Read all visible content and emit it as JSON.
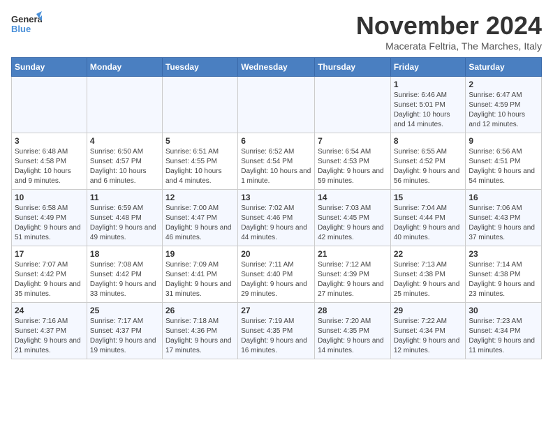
{
  "header": {
    "logo_general": "General",
    "logo_blue": "Blue",
    "month": "November 2024",
    "location": "Macerata Feltria, The Marches, Italy"
  },
  "weekdays": [
    "Sunday",
    "Monday",
    "Tuesday",
    "Wednesday",
    "Thursday",
    "Friday",
    "Saturday"
  ],
  "weeks": [
    [
      {
        "day": "",
        "info": ""
      },
      {
        "day": "",
        "info": ""
      },
      {
        "day": "",
        "info": ""
      },
      {
        "day": "",
        "info": ""
      },
      {
        "day": "",
        "info": ""
      },
      {
        "day": "1",
        "info": "Sunrise: 6:46 AM\nSunset: 5:01 PM\nDaylight: 10 hours and 14 minutes."
      },
      {
        "day": "2",
        "info": "Sunrise: 6:47 AM\nSunset: 4:59 PM\nDaylight: 10 hours and 12 minutes."
      }
    ],
    [
      {
        "day": "3",
        "info": "Sunrise: 6:48 AM\nSunset: 4:58 PM\nDaylight: 10 hours and 9 minutes."
      },
      {
        "day": "4",
        "info": "Sunrise: 6:50 AM\nSunset: 4:57 PM\nDaylight: 10 hours and 6 minutes."
      },
      {
        "day": "5",
        "info": "Sunrise: 6:51 AM\nSunset: 4:55 PM\nDaylight: 10 hours and 4 minutes."
      },
      {
        "day": "6",
        "info": "Sunrise: 6:52 AM\nSunset: 4:54 PM\nDaylight: 10 hours and 1 minute."
      },
      {
        "day": "7",
        "info": "Sunrise: 6:54 AM\nSunset: 4:53 PM\nDaylight: 9 hours and 59 minutes."
      },
      {
        "day": "8",
        "info": "Sunrise: 6:55 AM\nSunset: 4:52 PM\nDaylight: 9 hours and 56 minutes."
      },
      {
        "day": "9",
        "info": "Sunrise: 6:56 AM\nSunset: 4:51 PM\nDaylight: 9 hours and 54 minutes."
      }
    ],
    [
      {
        "day": "10",
        "info": "Sunrise: 6:58 AM\nSunset: 4:49 PM\nDaylight: 9 hours and 51 minutes."
      },
      {
        "day": "11",
        "info": "Sunrise: 6:59 AM\nSunset: 4:48 PM\nDaylight: 9 hours and 49 minutes."
      },
      {
        "day": "12",
        "info": "Sunrise: 7:00 AM\nSunset: 4:47 PM\nDaylight: 9 hours and 46 minutes."
      },
      {
        "day": "13",
        "info": "Sunrise: 7:02 AM\nSunset: 4:46 PM\nDaylight: 9 hours and 44 minutes."
      },
      {
        "day": "14",
        "info": "Sunrise: 7:03 AM\nSunset: 4:45 PM\nDaylight: 9 hours and 42 minutes."
      },
      {
        "day": "15",
        "info": "Sunrise: 7:04 AM\nSunset: 4:44 PM\nDaylight: 9 hours and 40 minutes."
      },
      {
        "day": "16",
        "info": "Sunrise: 7:06 AM\nSunset: 4:43 PM\nDaylight: 9 hours and 37 minutes."
      }
    ],
    [
      {
        "day": "17",
        "info": "Sunrise: 7:07 AM\nSunset: 4:42 PM\nDaylight: 9 hours and 35 minutes."
      },
      {
        "day": "18",
        "info": "Sunrise: 7:08 AM\nSunset: 4:42 PM\nDaylight: 9 hours and 33 minutes."
      },
      {
        "day": "19",
        "info": "Sunrise: 7:09 AM\nSunset: 4:41 PM\nDaylight: 9 hours and 31 minutes."
      },
      {
        "day": "20",
        "info": "Sunrise: 7:11 AM\nSunset: 4:40 PM\nDaylight: 9 hours and 29 minutes."
      },
      {
        "day": "21",
        "info": "Sunrise: 7:12 AM\nSunset: 4:39 PM\nDaylight: 9 hours and 27 minutes."
      },
      {
        "day": "22",
        "info": "Sunrise: 7:13 AM\nSunset: 4:38 PM\nDaylight: 9 hours and 25 minutes."
      },
      {
        "day": "23",
        "info": "Sunrise: 7:14 AM\nSunset: 4:38 PM\nDaylight: 9 hours and 23 minutes."
      }
    ],
    [
      {
        "day": "24",
        "info": "Sunrise: 7:16 AM\nSunset: 4:37 PM\nDaylight: 9 hours and 21 minutes."
      },
      {
        "day": "25",
        "info": "Sunrise: 7:17 AM\nSunset: 4:37 PM\nDaylight: 9 hours and 19 minutes."
      },
      {
        "day": "26",
        "info": "Sunrise: 7:18 AM\nSunset: 4:36 PM\nDaylight: 9 hours and 17 minutes."
      },
      {
        "day": "27",
        "info": "Sunrise: 7:19 AM\nSunset: 4:35 PM\nDaylight: 9 hours and 16 minutes."
      },
      {
        "day": "28",
        "info": "Sunrise: 7:20 AM\nSunset: 4:35 PM\nDaylight: 9 hours and 14 minutes."
      },
      {
        "day": "29",
        "info": "Sunrise: 7:22 AM\nSunset: 4:34 PM\nDaylight: 9 hours and 12 minutes."
      },
      {
        "day": "30",
        "info": "Sunrise: 7:23 AM\nSunset: 4:34 PM\nDaylight: 9 hours and 11 minutes."
      }
    ]
  ]
}
